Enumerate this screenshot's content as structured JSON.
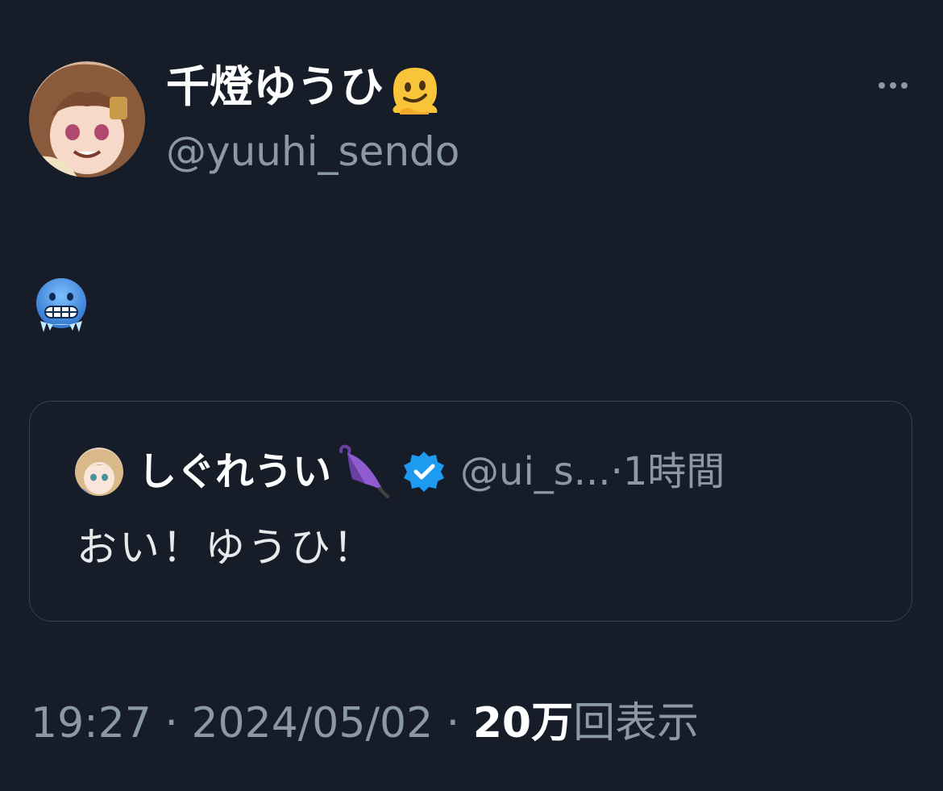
{
  "tweet": {
    "author": {
      "display_name": "千燈ゆうひ",
      "handle": "@yuuhi_sendo"
    },
    "body_emoji_icon": "cold-face-icon",
    "quote": {
      "display_name": "しぐれうい",
      "handle_truncated": "@ui_s...",
      "meta": "·1時間",
      "text": "おい！ゆうひ！",
      "verified_color": "#1d9bf0"
    },
    "timestamp": "19:27 · 2024/05/02 · ",
    "views_count": "20万",
    "views_label": "回表示"
  },
  "colors": {
    "background": "#161d29",
    "border": "#35404d",
    "secondary_text": "#8b98a5",
    "primary_text": "#ffffff"
  }
}
